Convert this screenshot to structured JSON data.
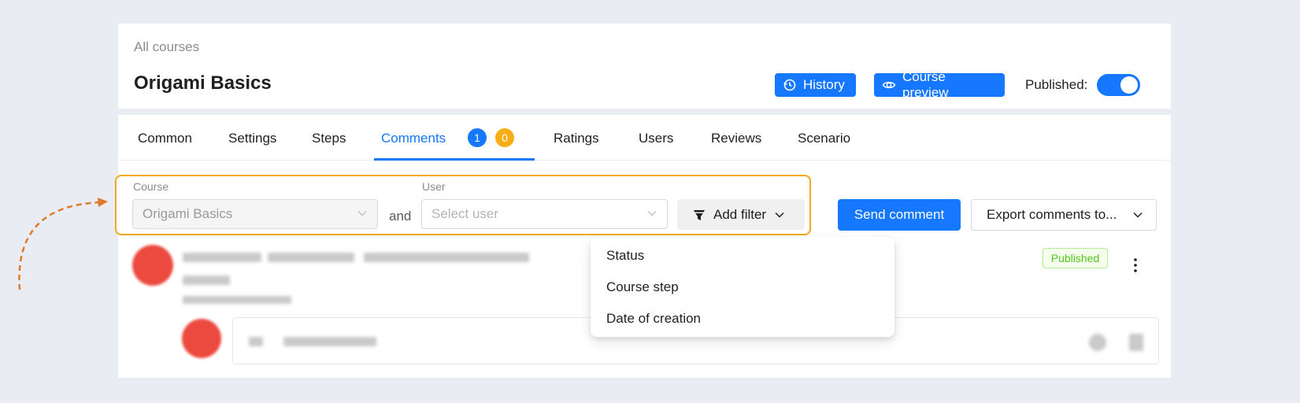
{
  "breadcrumb": "All courses",
  "page_title": "Origami Basics",
  "header": {
    "history_label": "History",
    "preview_label": "Course preview",
    "published_label": "Published:",
    "published_on": true
  },
  "tabs": [
    {
      "label": "Common"
    },
    {
      "label": "Settings"
    },
    {
      "label": "Steps"
    },
    {
      "label": "Comments",
      "active": true,
      "badge_blue": "1",
      "badge_orange": "0"
    },
    {
      "label": "Ratings"
    },
    {
      "label": "Users"
    },
    {
      "label": "Reviews"
    },
    {
      "label": "Scenario"
    }
  ],
  "filters": {
    "course_label": "Course",
    "course_value": "Origami Basics",
    "and_text": "and",
    "user_label": "User",
    "user_placeholder": "Select user",
    "add_filter_label": "Add filter"
  },
  "actions": {
    "send_comment": "Send comment",
    "export_comments": "Export comments to..."
  },
  "comment": {
    "status": "Published"
  },
  "add_filter_menu": [
    "Status",
    "Course step",
    "Date of creation"
  ],
  "colors": {
    "primary": "#1677ff",
    "highlight": "#f0a81c",
    "badge_orange": "#faad14",
    "avatar": "#ec4a3f",
    "published_green": "#52c41a"
  }
}
